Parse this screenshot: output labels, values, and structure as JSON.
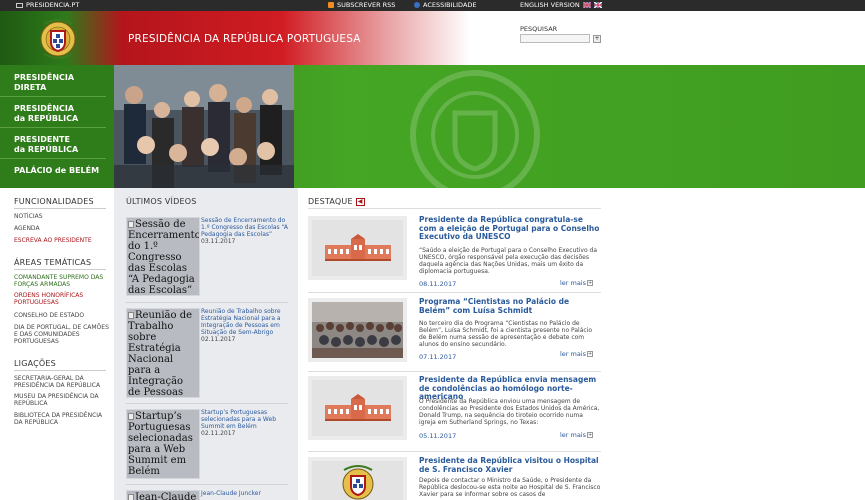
{
  "topbar": {
    "site": "PRESIDENCIA.PT",
    "rss": "SUBSCREVER RSS",
    "access": "ACESSIBILIDADE",
    "english": "ENGLISH VERSION"
  },
  "header": {
    "title": "PRESIDÊNCIA DA REPÚBLICA PORTUGUESA",
    "search_label": "PESQUISAR",
    "search_button": "+"
  },
  "nav": [
    {
      "line1": "PRESIDÊNCIA",
      "line2": "DIRETA"
    },
    {
      "line1": "PRESIDÊNCIA",
      "line2": "da REPÚBLICA"
    },
    {
      "line1": "PRESIDENTE",
      "line2": "da REPÚBLICA"
    },
    {
      "line1": "PALÁCIO de BELÉM",
      "line2": ""
    }
  ],
  "left": {
    "funcionalidades": {
      "title": "FUNCIONALIDADES",
      "links": [
        "NOTÍCIAS",
        "AGENDA",
        "ESCREVA AO PRESIDENTE"
      ]
    },
    "areas": {
      "title": "ÁREAS TEMÁTICAS",
      "links": [
        "COMANDANTE SUPREMO DAS FORÇAS ARMADAS",
        "ORDENS HONORÍFICAS PORTUGUESAS",
        "CONSELHO DE ESTADO",
        "DIA DE PORTUGAL, DE CAMÕES E DAS COMUNIDADES PORTUGUESAS"
      ]
    },
    "ligacoes": {
      "title": "LIGAÇÕES",
      "links": [
        "SECRETARIA-GERAL DA PRESIDÊNCIA DA REPÚBLICA",
        "MUSEU DA PRESIDÊNCIA DA REPÚBLICA",
        "BIBLIOTECA DA PRESIDÊNCIA DA REPÚBLICA"
      ]
    }
  },
  "videos": {
    "title": "ÚLTIMOS VÍDEOS",
    "items": [
      {
        "alt": "Sessão de Encerramento do 1.º Congresso das Escolas “A Pedagogia das Escolas”",
        "text": "Sessão de Encerramento do 1.º Congresso das Escolas “A Pedagogia das Escolas”",
        "date": "03.11.2017"
      },
      {
        "alt": "Reunião de Trabalho sobre Estratégia Nacional para a Integração de Pessoas em Situação de Sem-Abrigo",
        "text": "Reunião de Trabalho sobre Estratégia Nacional para a Integração de Pessoas em Situação de Sem-Abrigo",
        "date": "02.11.2017"
      },
      {
        "alt": "Startup’s Portuguesas selecionadas para a Web Summit em Belém",
        "text": "Startup’s Portuguesas selecionadas para a Web Summit em Belém",
        "date": "02.11.2017"
      },
      {
        "alt": "Jean-Claude",
        "text": "Jean-Claude Juncker",
        "date": ""
      }
    ]
  },
  "destaque": {
    "title": "DESTAQUE",
    "more_label": "ler mais",
    "items": [
      {
        "title": "Presidente da República congratula-se com a eleição de Portugal para o Conselho Executivo da UNESCO",
        "body": "“Saúdo a eleição de Portugal para o Conselho Executivo da UNESCO, órgão responsável pela execução das decisões daquela agência das Nações Unidas, mais um êxito da diplomacia portuguesa.",
        "date": "08.11.2017"
      },
      {
        "title": "Programa “Cientistas no Palácio de Belém” com Luísa Schmidt",
        "body": "No terceiro dia do Programa “Cientistas no Palácio de Belém”, Luísa Schmidt, foi a cientista presente no Palácio de Belém numa sessão de apresentação e debate com alunos do ensino secundário.",
        "date": "07.11.2017"
      },
      {
        "title": "Presidente da República envia mensagem de condolências ao homólogo norte-americano",
        "body": "O Presidente da República enviou uma mensagem de condolências ao Presidente dos Estados Unidos da América, Donald Trump, na sequência do tiroteio ocorrido numa igreja em Sutherland Springs, no Texas:",
        "date": "05.11.2017"
      },
      {
        "title": "Presidente da República visitou o Hospital de S. Francisco Xavier",
        "body": "Depois de contactar o Ministro da Saúde, o Presidente da República deslocou-se esta noite ao Hospital de S. Francisco Xavier para se informar sobre os casos de",
        "date": ""
      }
    ]
  },
  "colors": {
    "green": "#2f7d1a",
    "red": "#a8161b",
    "link_blue": "#2a5a9a"
  }
}
